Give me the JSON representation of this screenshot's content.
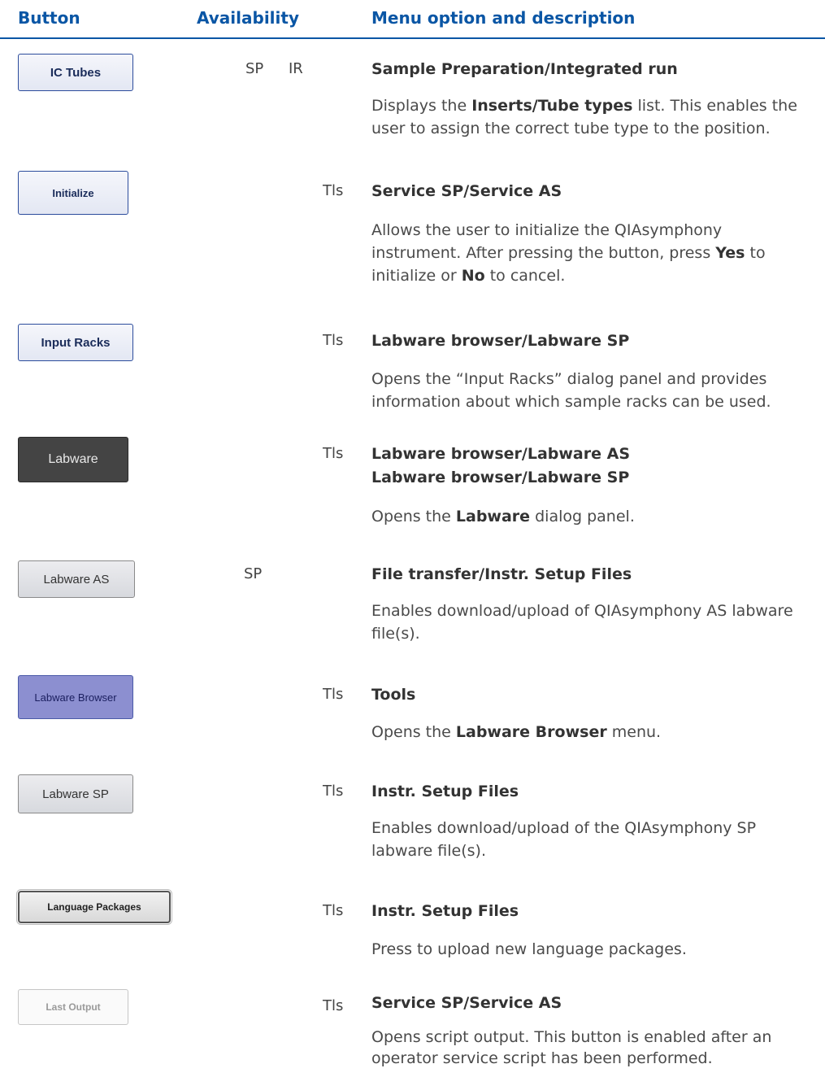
{
  "header": {
    "col_button": "Button",
    "col_availability": "Availability",
    "col_menu": "Menu option and description"
  },
  "rows": [
    {
      "button_label": "IC Tubes",
      "avail_sp": "SP",
      "avail_ir": "IR",
      "option": "Sample Preparation/Integrated run",
      "desc_1": "Displays the ",
      "desc_b1": "Inserts/Tube types",
      "desc_2": " list. This enables the user to assign the correct tube type to the position."
    },
    {
      "button_label": "Initialize",
      "avail_tls": "Tls",
      "option": "Service SP/Service AS",
      "desc_1": "Allows the user to initialize the QIAsymphony instrument. After pressing the button, press ",
      "desc_b1": "Yes",
      "desc_2": " to initialize or ",
      "desc_b2": "No",
      "desc_3": " to cancel."
    },
    {
      "button_label": "Input Racks",
      "avail_tls": "Tls",
      "option": "Labware browser/Labware SP",
      "desc_1": "Opens the “Input Racks” dialog panel and provides information about which sample racks can be used."
    },
    {
      "button_label": "Labware",
      "avail_tls": "Tls",
      "option": "Labware browser/Labware AS",
      "option_2": "Labware browser/Labware SP",
      "desc_1": "Opens the ",
      "desc_b1": "Labware",
      "desc_2": " dialog panel."
    },
    {
      "button_label": "Labware AS",
      "avail_sp": "SP",
      "option": "File transfer/Instr. Setup Files",
      "desc_1": "Enables download/upload of QIAsymphony AS labware file(s)."
    },
    {
      "button_label": "Labware Browser",
      "avail_tls": "Tls",
      "option": "Tools",
      "desc_1": "Opens the ",
      "desc_b1": "Labware Browser",
      "desc_2": " menu."
    },
    {
      "button_label": "Labware SP",
      "avail_tls": "Tls",
      "option": "Instr. Setup Files",
      "desc_1": "Enables download/upload of the QIAsymphony SP labware file(s)."
    },
    {
      "button_label": "Language Packages",
      "avail_tls": "Tls",
      "option": "Instr. Setup Files",
      "desc_1": "Press to upload new language packages."
    },
    {
      "button_label": "Last Output",
      "avail_tls": "Tls",
      "option": "Service SP/Service AS",
      "desc_1": "Opens script output. This button is enabled after an operator service script has been performed."
    }
  ]
}
